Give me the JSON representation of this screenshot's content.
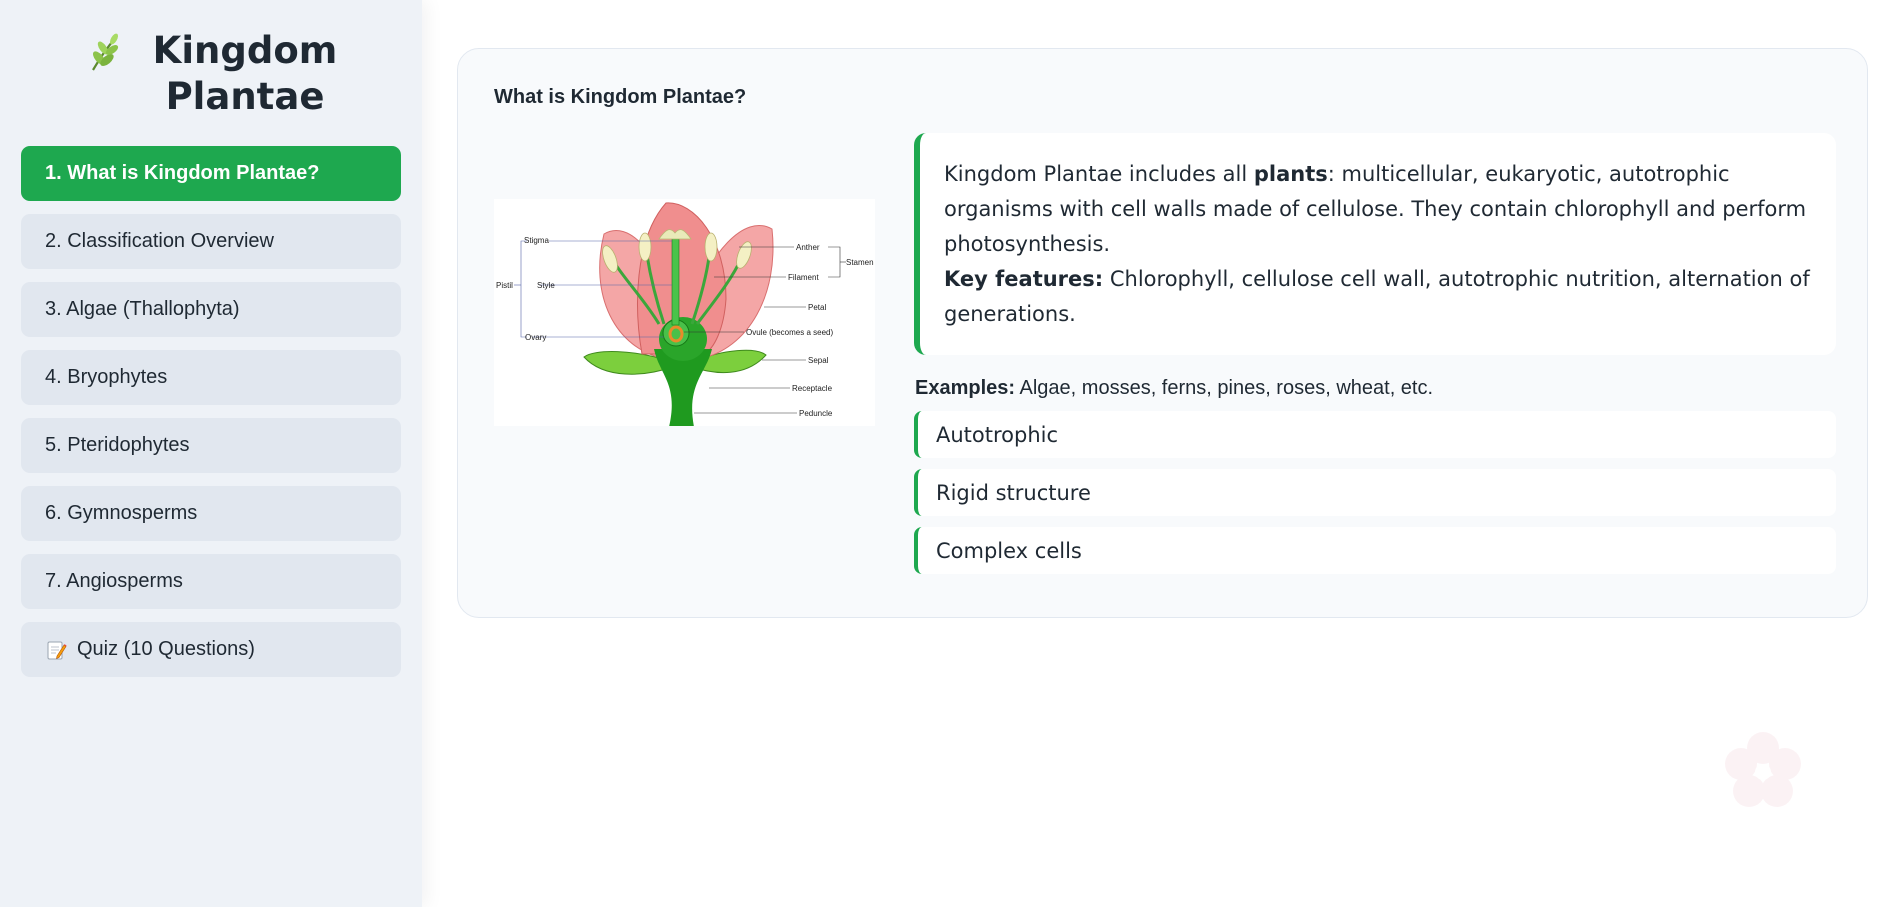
{
  "sidebar": {
    "brand_icon": "leaf-icon",
    "title_line1": "Kingdom",
    "title_line2": "Plantae",
    "items": [
      {
        "label": "1. What is Kingdom Plantae?",
        "active": true
      },
      {
        "label": "2. Classification Overview"
      },
      {
        "label": "3. Algae (Thallophyta)"
      },
      {
        "label": "4. Bryophytes"
      },
      {
        "label": "5. Pteridophytes"
      },
      {
        "label": "6. Gymnosperms"
      },
      {
        "label": "7. Angiosperms"
      },
      {
        "label": "Quiz (10 Questions)",
        "icon": "memo-icon"
      }
    ]
  },
  "main": {
    "title": "What is Kingdom Plantae?",
    "diagram": {
      "icon": "flower-diagram",
      "labels": {
        "stigma": "Stigma",
        "pistil": "Pistil",
        "style": "Style",
        "ovary": "Ovary",
        "anther": "Anther",
        "stamen": "Stamen",
        "filament": "Filament",
        "petal": "Petal",
        "ovule": "Ovule (becomes a seed)",
        "sepal": "Sepal",
        "receptacle": "Receptacle",
        "peduncle": "Peduncle"
      }
    },
    "info": {
      "intro": "Kingdom Plantae includes all ",
      "intro_bold": "plants",
      "intro_rest": ": multicellular, eukaryotic, autotrophic organisms with cell walls made of cellulose. They contain chlorophyll and perform photosynthesis.",
      "features_label": "Key features:",
      "features_text": " Chlorophyll, cellulose cell wall, autotrophic nutrition, alternation of generations."
    },
    "examples_label": "Examples:",
    "examples_text": " Algae, mosses, ferns, pines, roses, wheat, etc.",
    "traits": [
      "Autotrophic",
      "Rigid structure",
      "Complex cells"
    ]
  },
  "colors": {
    "accent": "#1ea84f",
    "sidebar_bg": "#eef2f7",
    "nav_bg": "#e1e7ef",
    "card_bg": "#f8fafc"
  }
}
